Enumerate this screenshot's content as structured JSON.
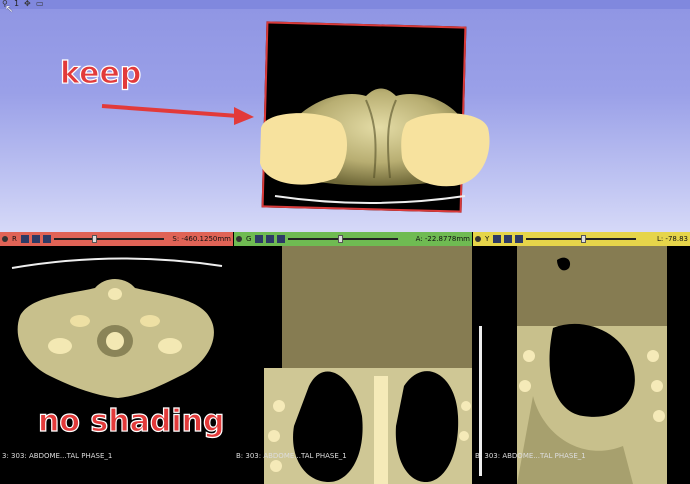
{
  "view3d": {
    "toolbar_number": "1",
    "annotation_keep": "keep",
    "colors": {
      "slab_border": "#d83a3a",
      "model": "#c9c086",
      "model_cut": "#f7e29e",
      "annotation": "#e23a3a"
    }
  },
  "red_view": {
    "orientation_label": "R",
    "offset": "S: -460.1250mm",
    "footer": "3: 303: ABDOME...TAL PHASE_1",
    "annotation": "no shading",
    "slider_fraction": 0.35,
    "color": "#e06356"
  },
  "green_view": {
    "orientation_label": "G",
    "offset": "A: -22.8778mm",
    "footer": "B: 303: ABDOME...TAL PHASE_1",
    "slider_fraction": 0.45,
    "color": "#6fbb52"
  },
  "yellow_view": {
    "orientation_label": "Y",
    "offset": "L: -78.83",
    "footer": "B: 303: ABDOME...TAL PHASE_1",
    "slider_fraction": 0.5,
    "color": "#e6d54a"
  }
}
